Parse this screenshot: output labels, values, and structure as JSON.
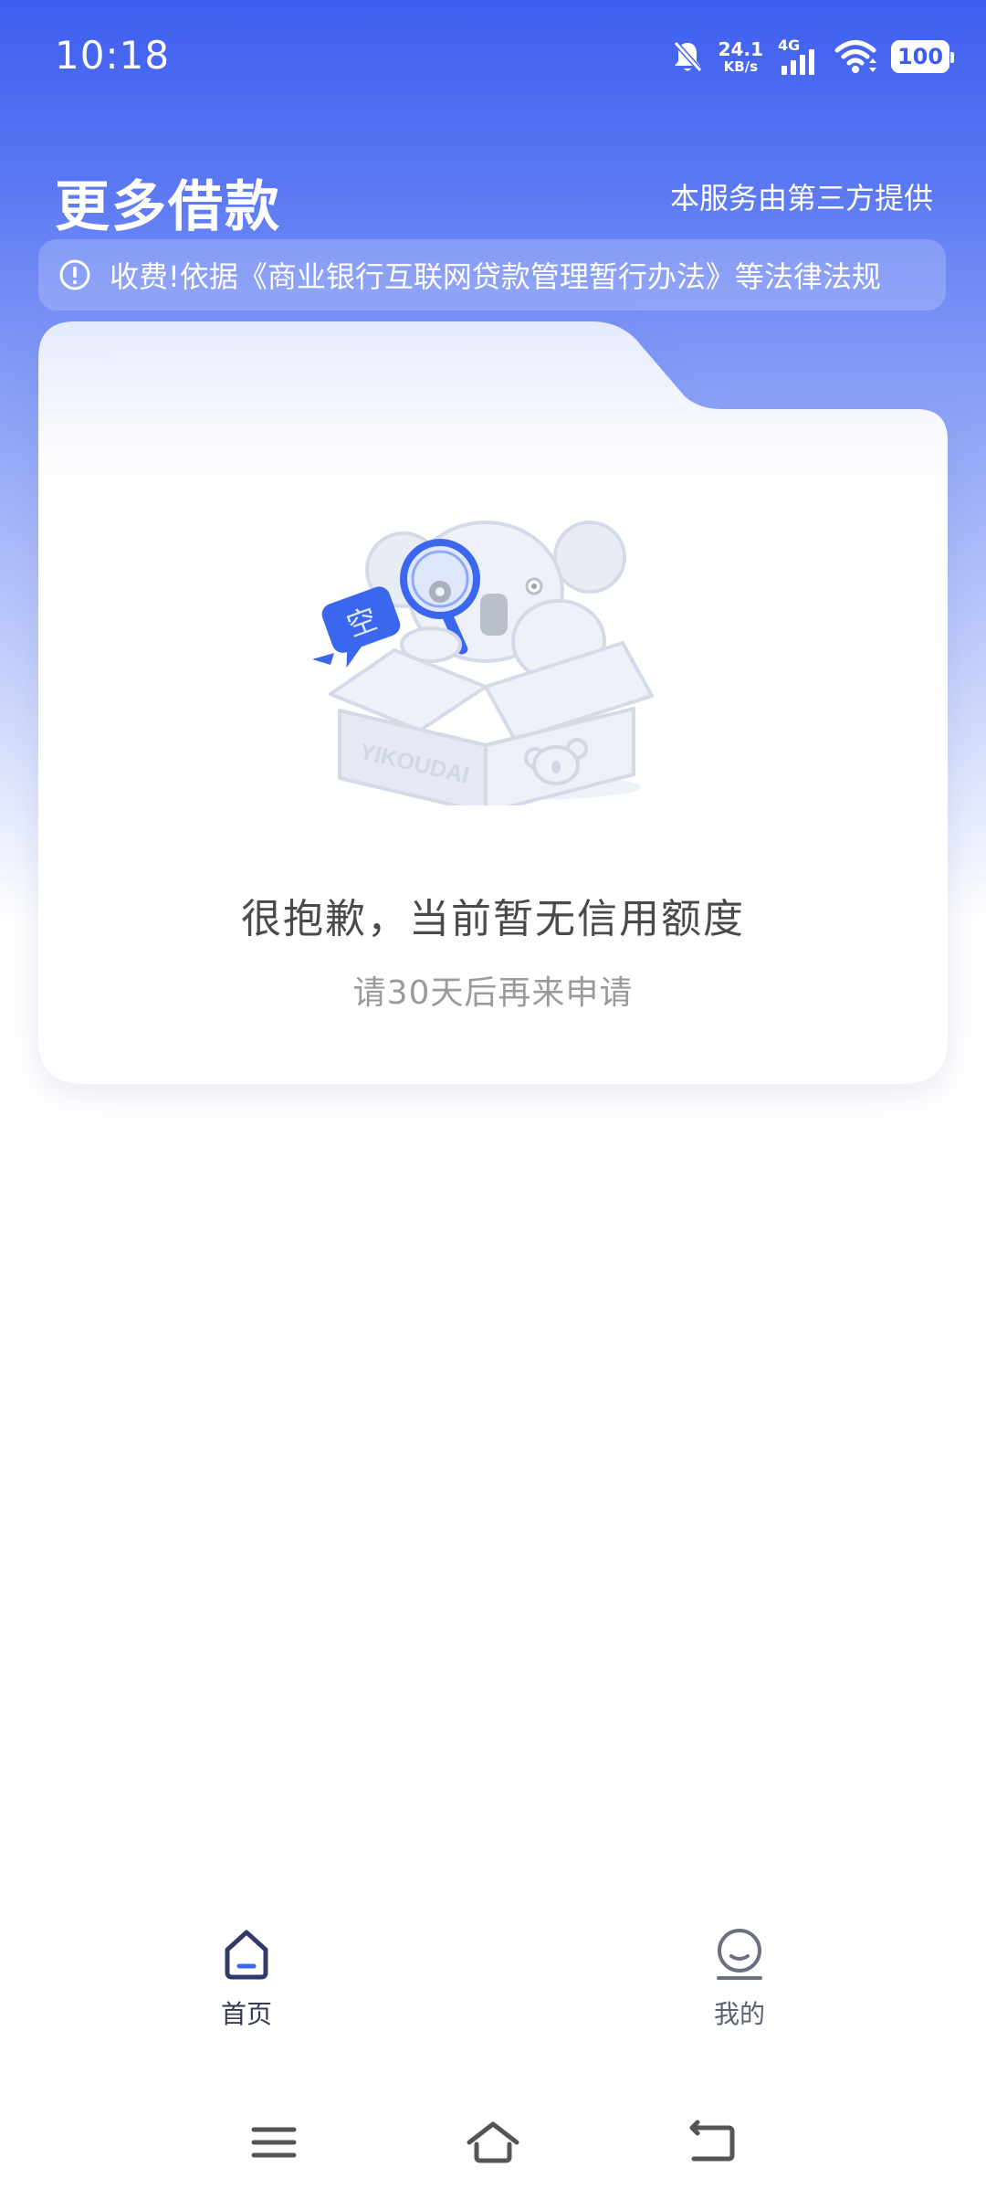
{
  "status_bar": {
    "time": "10:18",
    "net_speed_value": "24.1",
    "net_speed_unit": "KB/s",
    "network_type": "4G",
    "battery": "100",
    "icons": [
      "mute-bell-icon",
      "signal-icon",
      "wifi-icon",
      "battery-icon"
    ]
  },
  "header": {
    "title": "更多借款",
    "provider_note": "本服务由第三方提供"
  },
  "notice": {
    "icon": "info-circle-icon",
    "text": "收费!依据《商业银行互联网贷款管理暂行办法》等法律法规"
  },
  "empty_state": {
    "illustration": "koala-in-box-illustration",
    "box_text": "YIKOUDAI",
    "bubble_text": "空",
    "title": "很抱歉，当前暂无信用额度",
    "subtitle": "请30天后再来申请"
  },
  "tab_bar": {
    "tabs": [
      {
        "label": "首页",
        "icon": "home-icon",
        "active": true
      },
      {
        "label": "我的",
        "icon": "profile-icon",
        "active": false
      }
    ]
  },
  "system_nav": {
    "buttons": [
      "menu-icon",
      "home-nav-icon",
      "back-icon"
    ]
  },
  "colors": {
    "brand_blue": "#3d5ef0",
    "illustration_blue": "#3b67ee",
    "title_text": "#4a4a4a",
    "subtitle_text": "#9a9a9a"
  }
}
